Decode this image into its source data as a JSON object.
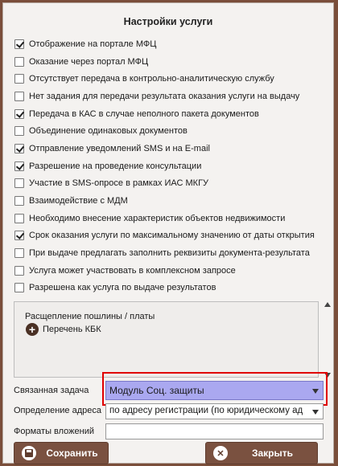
{
  "dialog": {
    "title": "Настройки услуги"
  },
  "checkboxes": [
    {
      "label": "Отображение на портале МФЦ",
      "checked": true
    },
    {
      "label": "Оказание через портал МФЦ",
      "checked": false
    },
    {
      "label": "Отсутствует передача в контрольно-аналитическую службу",
      "checked": false
    },
    {
      "label": "Нет задания для передачи результата оказания услуги на выдачу",
      "checked": false
    },
    {
      "label": "Передача в КАС в случае неполного пакета документов",
      "checked": true
    },
    {
      "label": "Объединение одинаковых документов",
      "checked": false
    },
    {
      "label": "Отправление уведомлений SMS и на E-mail",
      "checked": true
    },
    {
      "label": "Разрешение на проведение консультации",
      "checked": true
    },
    {
      "label": "Участие в SMS-опросе в рамках ИАС МКГУ",
      "checked": false
    },
    {
      "label": "Взаимодействие с МДМ",
      "checked": false
    },
    {
      "label": "Необходимо внесение характеристик объектов недвижимости",
      "checked": false
    },
    {
      "label": "Срок оказания услуги по максимальному значению от даты открытия",
      "checked": true
    },
    {
      "label": "При выдаче предлагать заполнить реквизиты документа-результата",
      "checked": false
    },
    {
      "label": "Услуга может участвовать в комплексном запросе",
      "checked": false
    },
    {
      "label": "Разрешена как услуга по выдаче результатов",
      "checked": false
    }
  ],
  "fees": {
    "title": "Расщепление пошлины / платы",
    "kbk_label": "Перечень КБК"
  },
  "fields": {
    "related_task_label": "Связанная задача",
    "related_task_value": "Модуль Соц. защиты",
    "address_label": "Определение адреса",
    "address_value": "по адресу регистрации (по юридическому ад",
    "attachments_label": "Форматы вложений",
    "attachments_value": ""
  },
  "buttons": {
    "save": "Сохранить",
    "close": "Закрыть"
  },
  "colors": {
    "frame": "#7a4e3a",
    "button": "#7a5140",
    "selected": "#aaa8f0",
    "highlight": "#e00000"
  }
}
